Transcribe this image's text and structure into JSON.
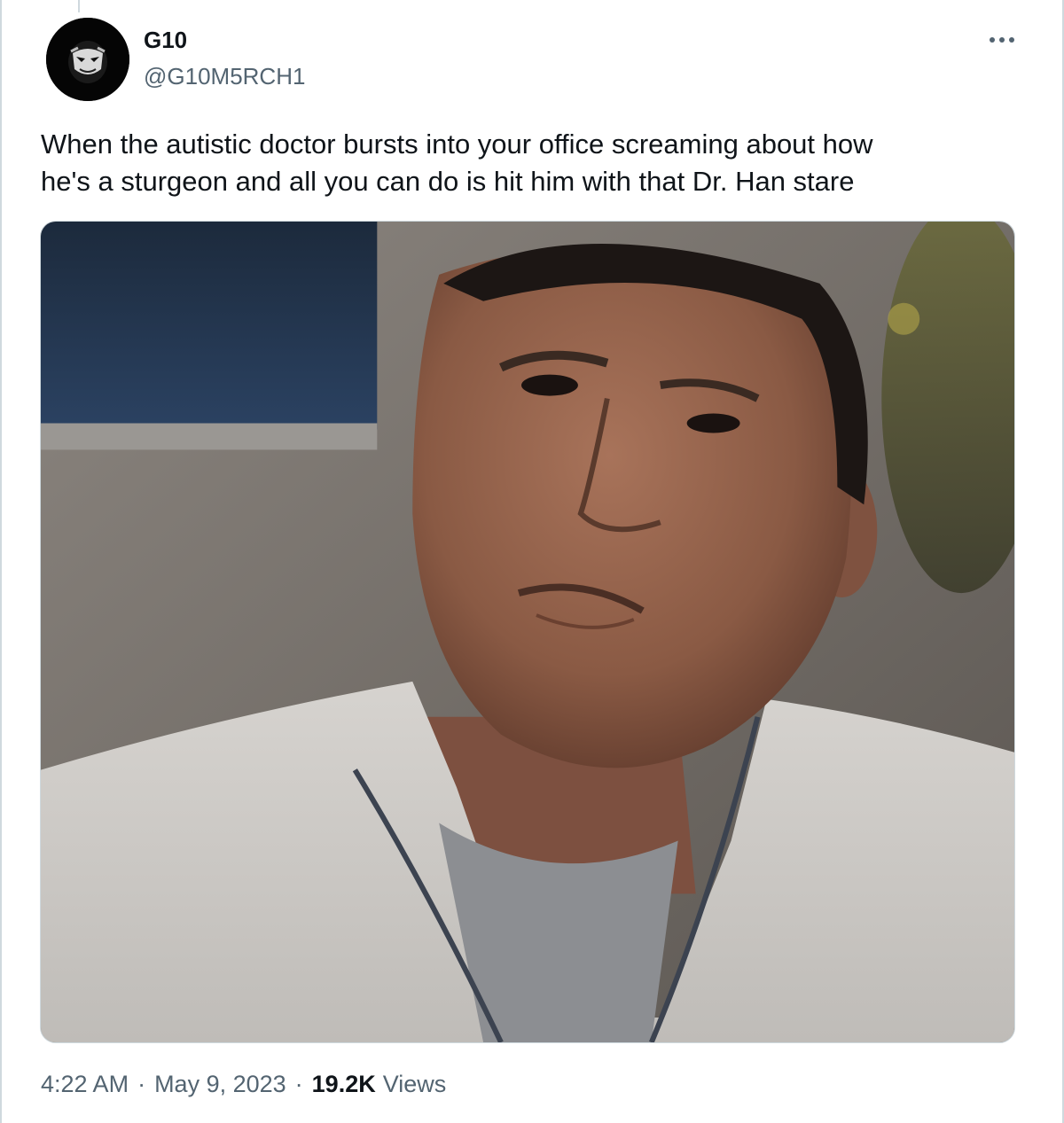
{
  "author": {
    "display_name": "G10",
    "handle": "@G10M5RCH1"
  },
  "tweet": {
    "text": "When the autistic doctor bursts into your office screaming about how\nhe's a sturgeon and all you can do is hit him with that Dr. Han stare",
    "time": "4:22 AM",
    "date": "May 9, 2023",
    "separator": "·",
    "views_count": "19.2K",
    "views_label": "Views"
  },
  "icons": {
    "more": "more-horizontal-icon",
    "avatar": "profile-avatar"
  },
  "colors": {
    "text_primary": "#0f1419",
    "text_secondary": "#536471",
    "border": "#cfd9de"
  }
}
